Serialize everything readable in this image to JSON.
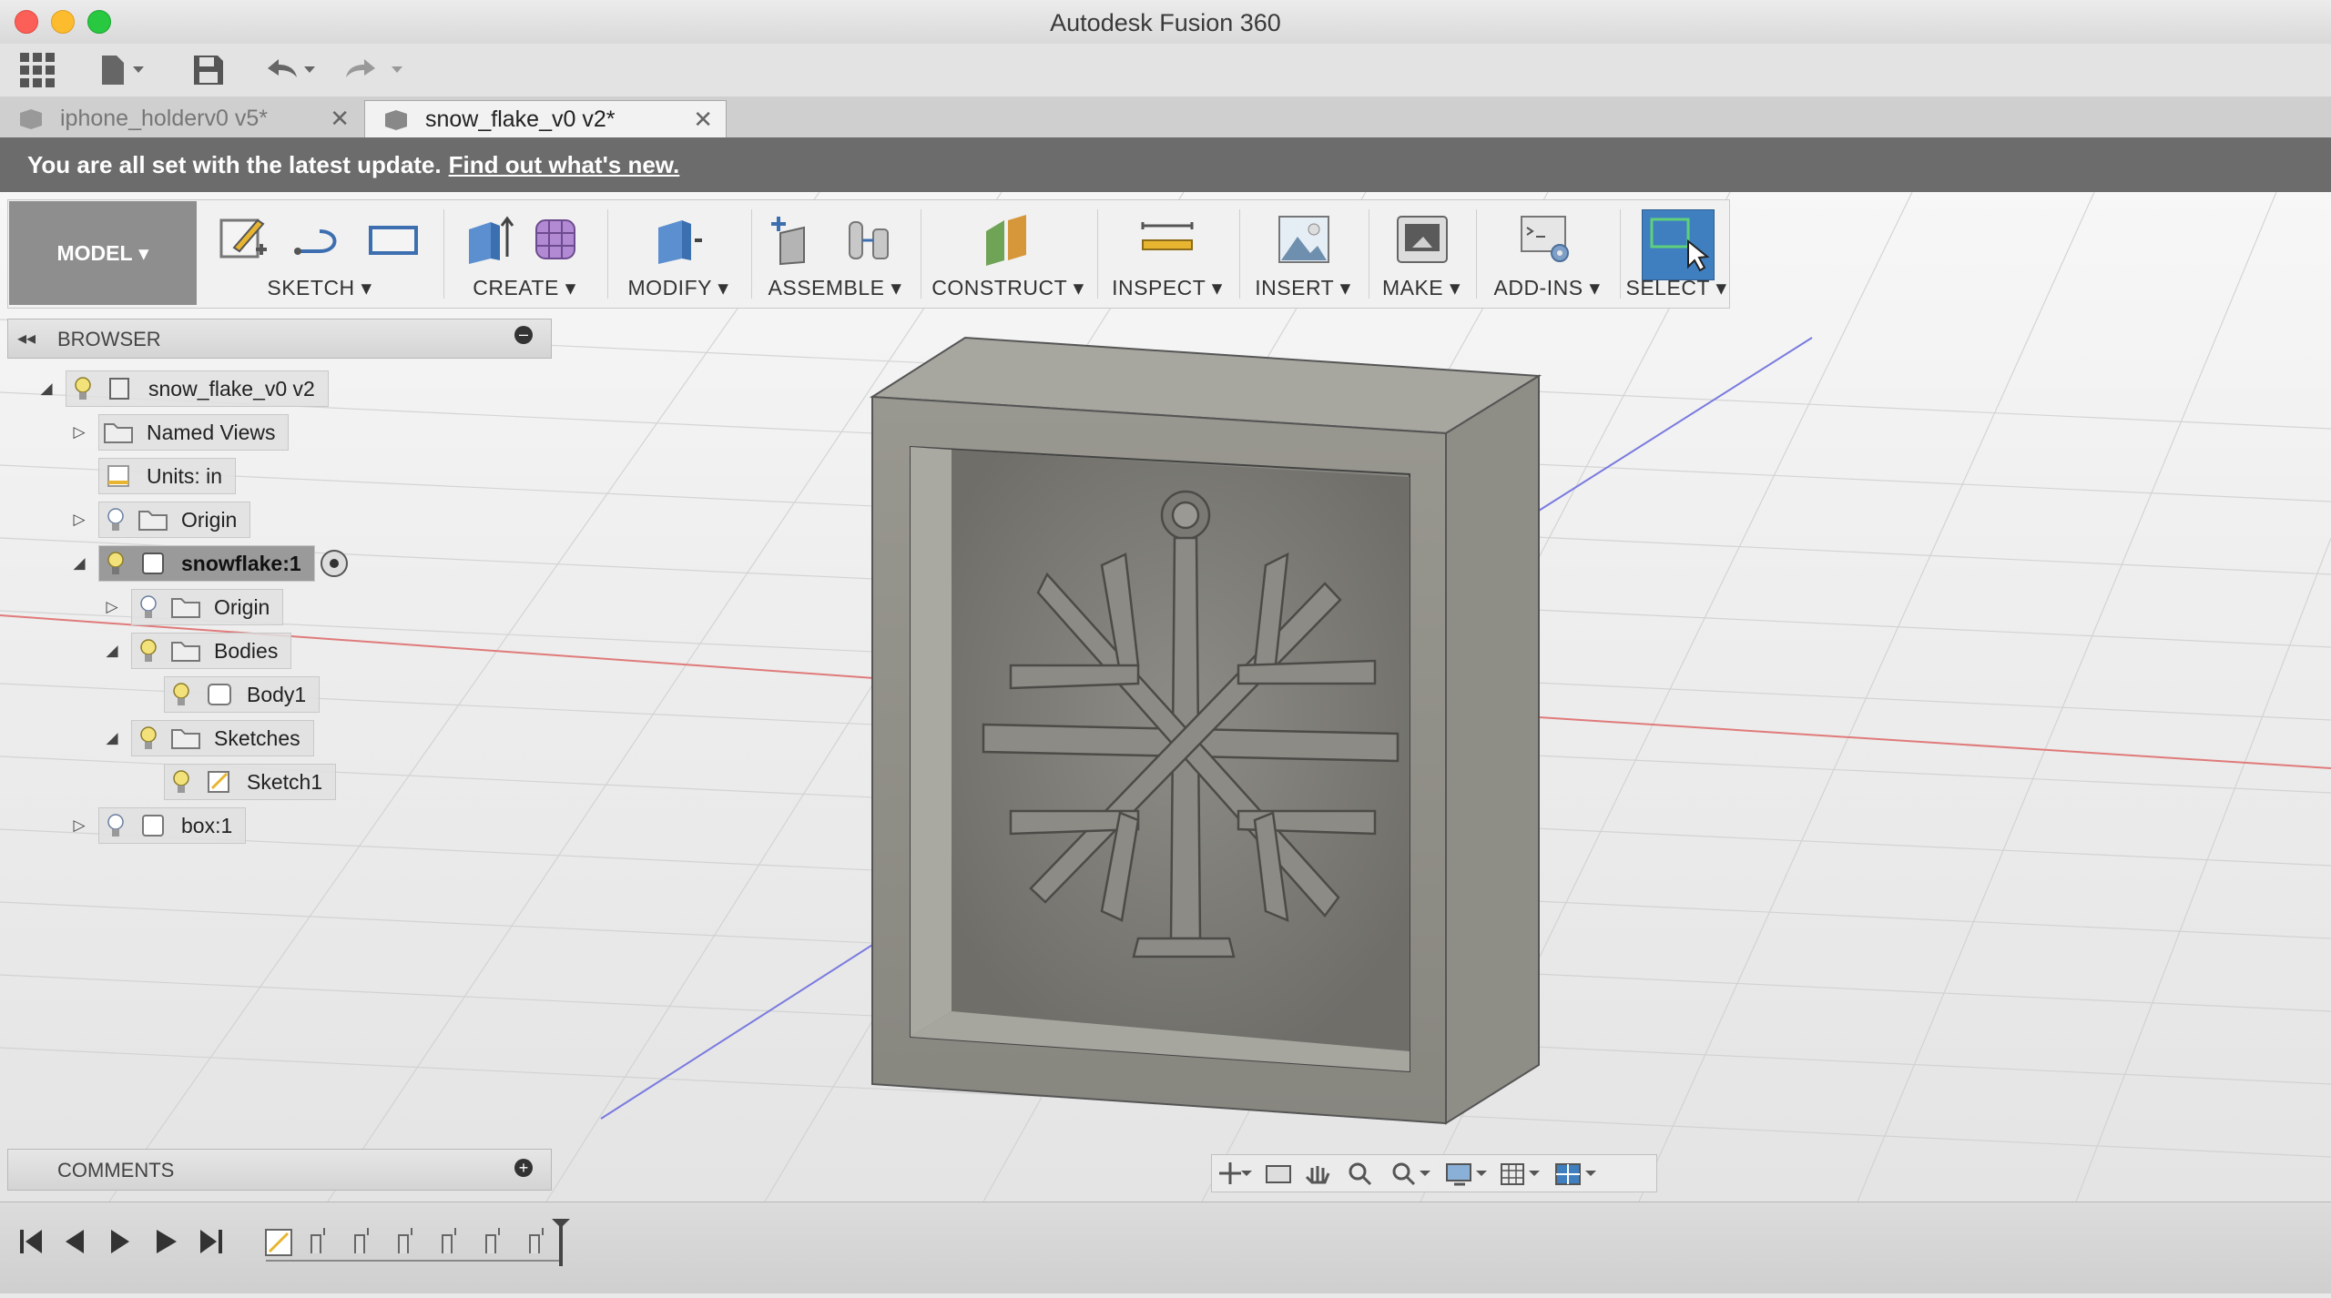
{
  "window": {
    "title": "Autodesk Fusion 360"
  },
  "tabs": [
    {
      "label": "iphone_holderv0 v5*",
      "active": false
    },
    {
      "label": "snow_flake_v0 v2*",
      "active": true
    }
  ],
  "notification": {
    "message": "You are all set with the latest update.",
    "link": "Find out what's new."
  },
  "ribbon": {
    "workspace": "MODEL",
    "groups": [
      "SKETCH",
      "CREATE",
      "MODIFY",
      "ASSEMBLE",
      "CONSTRUCT",
      "INSPECT",
      "INSERT",
      "MAKE",
      "ADD-INS",
      "SELECT"
    ]
  },
  "browser": {
    "title": "BROWSER",
    "root": "snow_flake_v0 v2",
    "named_views": "Named Views",
    "units": "Units: in",
    "origin": "Origin",
    "component": "snowflake:1",
    "comp_origin": "Origin",
    "bodies": "Bodies",
    "body1": "Body1",
    "sketches": "Sketches",
    "sketch1": "Sketch1",
    "box": "box:1"
  },
  "comments": {
    "title": "COMMENTS"
  },
  "colors": {
    "accent_select": "#3f7fbf",
    "notify_bg": "#6c6c6c",
    "model_bg": "#8e8e8e"
  },
  "icons": [
    "apps-grid-icon",
    "file-icon",
    "save-icon",
    "undo-icon",
    "redo-icon",
    "lightbulb-icon",
    "folder-icon",
    "component-icon",
    "orbit-icon",
    "look-at-icon",
    "pan-icon",
    "zoom-icon",
    "zoom-window-icon",
    "display-settings-icon",
    "grid-icon",
    "viewports-icon",
    "timeline-first-icon",
    "timeline-prev-icon",
    "timeline-play-icon",
    "timeline-next-icon",
    "timeline-last-icon"
  ]
}
